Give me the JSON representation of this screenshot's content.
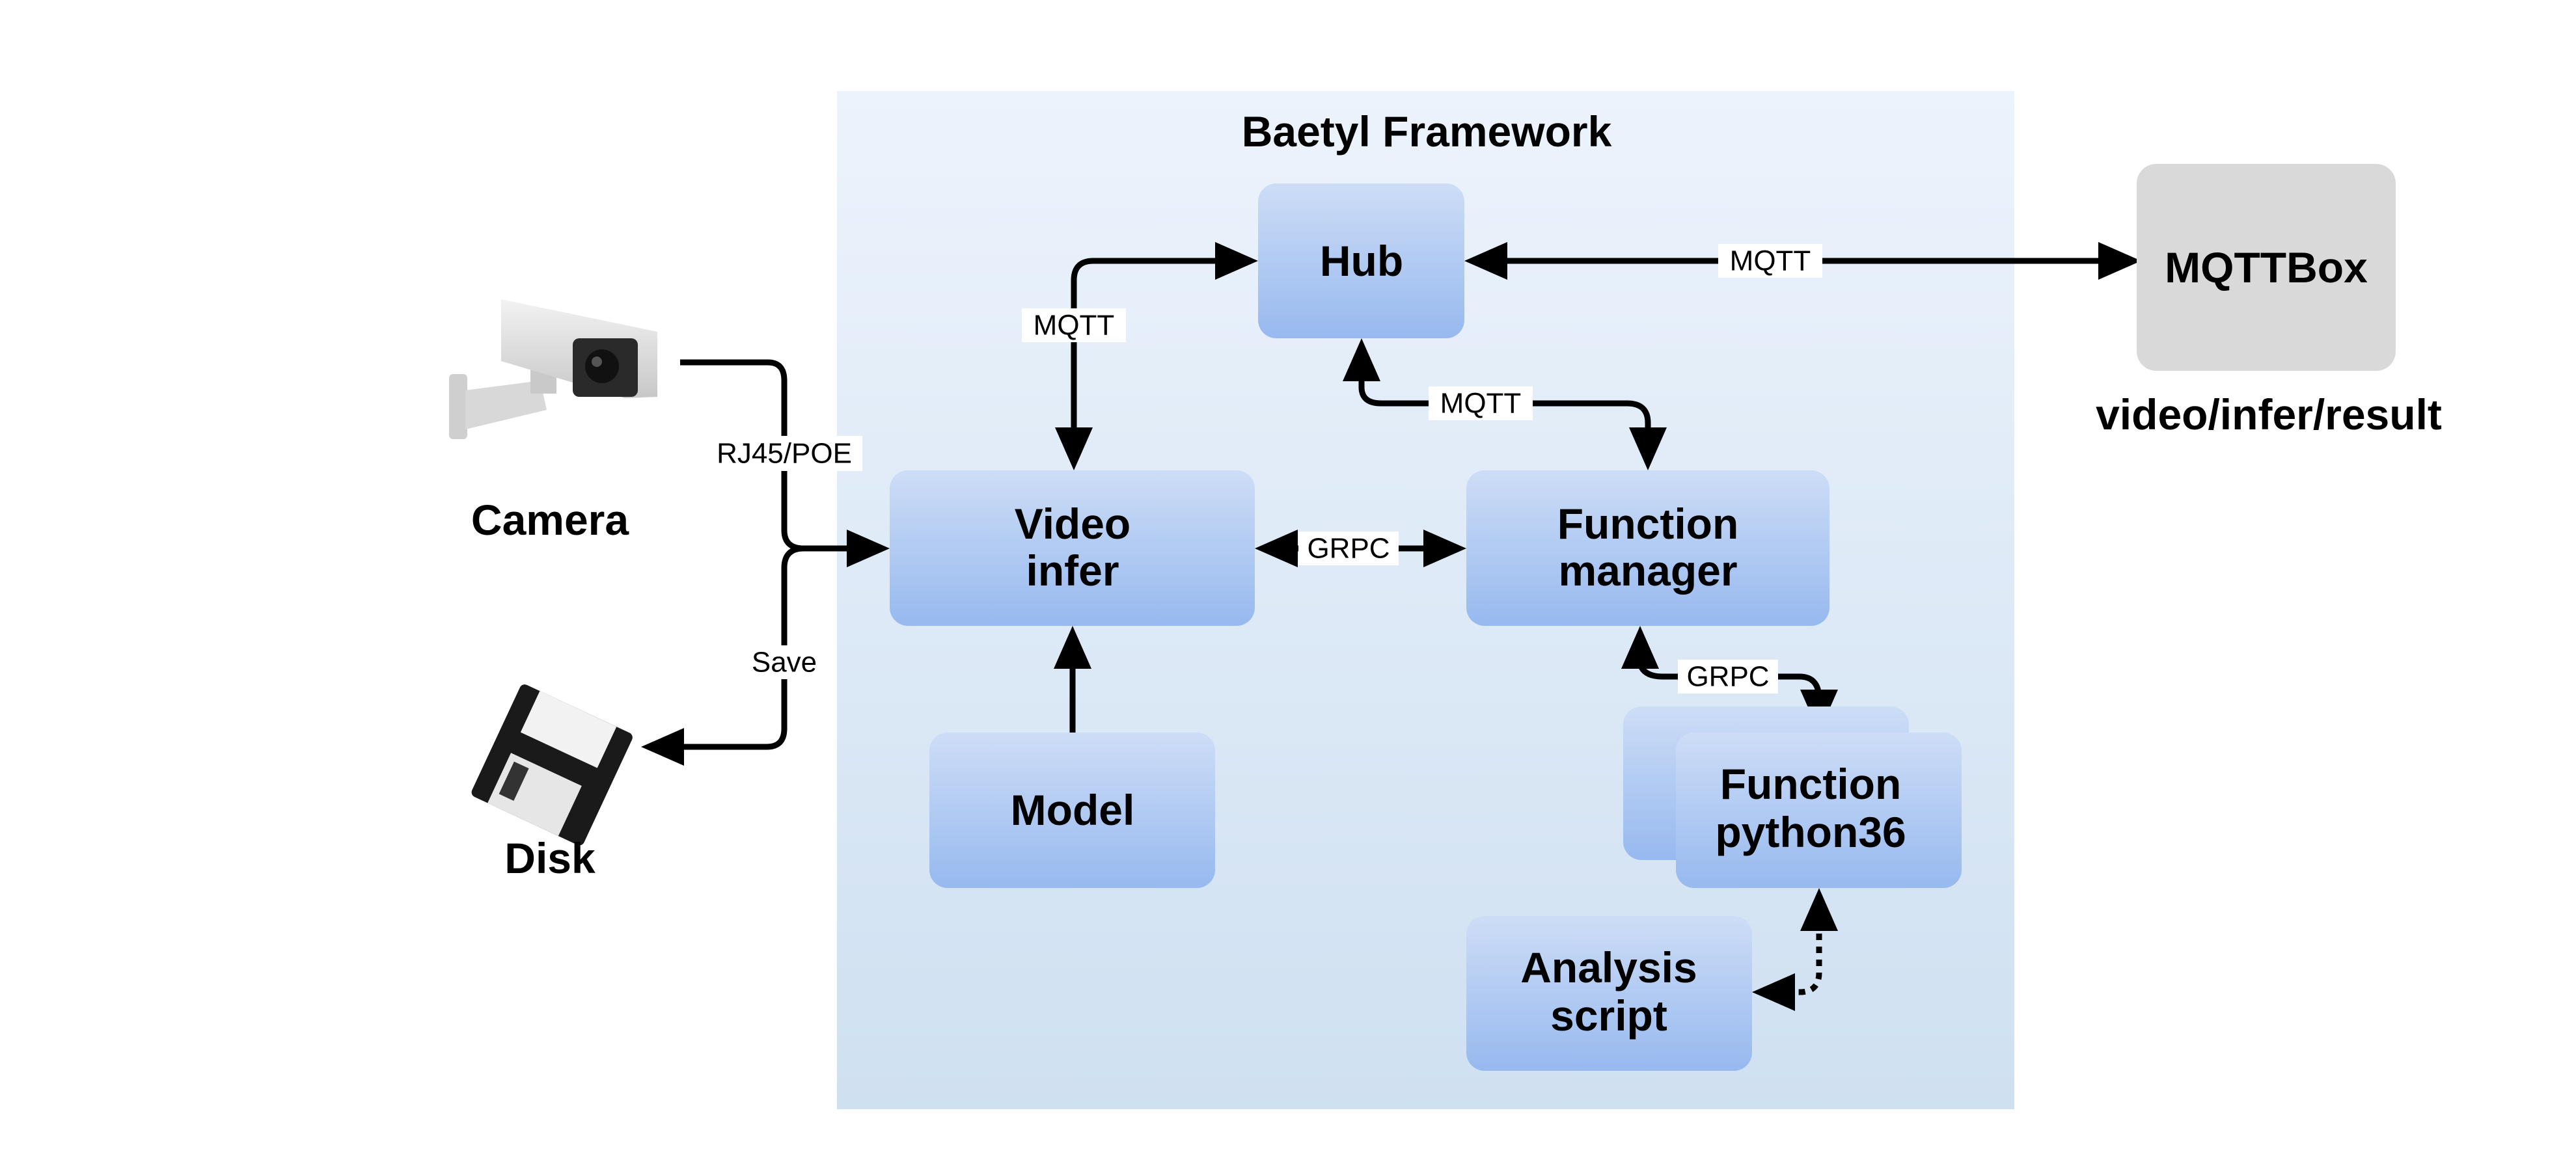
{
  "framework": {
    "title": "Baetyl Framework"
  },
  "nodes": {
    "hub": {
      "label": "Hub"
    },
    "mqttbox": {
      "label": "MQTTBox",
      "topic": "video/infer/result"
    },
    "video_infer": {
      "line1": "Video",
      "line2": "infer"
    },
    "function_manager": {
      "line1": "Function",
      "line2": "manager"
    },
    "model": {
      "label": "Model"
    },
    "function_python36": {
      "line1": "Function",
      "line2": "python36"
    },
    "analysis_script": {
      "line1": "Analysis",
      "line2": "script"
    },
    "camera": {
      "label": "Camera"
    },
    "disk": {
      "label": "Disk"
    }
  },
  "edges": {
    "hub_mqttbox": "MQTT",
    "hub_video_infer": "MQTT",
    "hub_function_manager": "MQTT",
    "video_infer_function_manager": "GRPC",
    "function_manager_python36": "GRPC",
    "camera_video_infer": "RJ45/POE",
    "video_infer_disk": "Save"
  },
  "colors": {
    "box_top": "#CDDDF6",
    "box_bottom": "#97B9EF",
    "framework_top": "#ECF3FC",
    "framework_bottom": "#CFE0F1",
    "mqttbox": "#D9D9D9"
  }
}
